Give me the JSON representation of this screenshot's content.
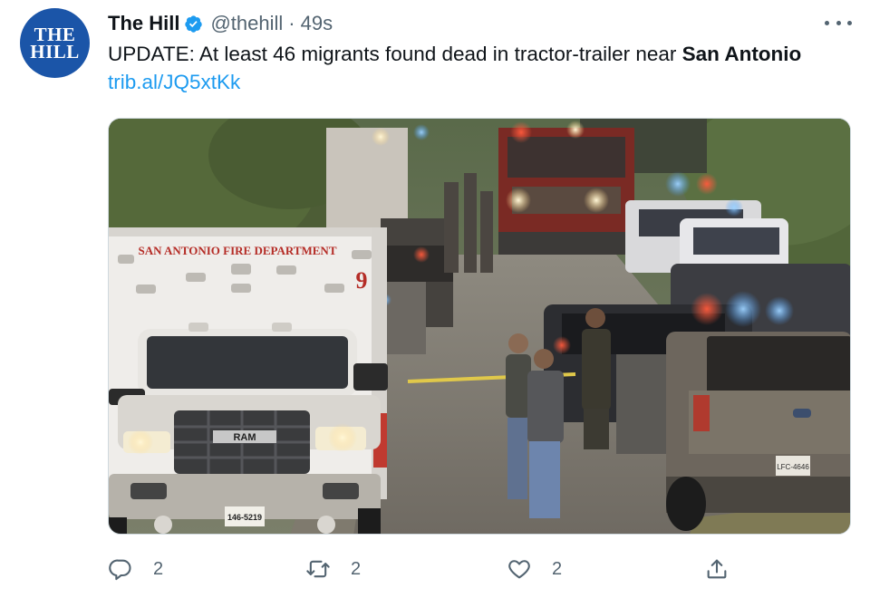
{
  "account": {
    "display_name": "The Hill",
    "handle": "@thehill",
    "separator": "·",
    "timestamp": "49s",
    "avatar_line1": "THE",
    "avatar_line2": "HILL",
    "verified": true
  },
  "tweet": {
    "text_prefix": "UPDATE: At least 46 migrants found dead in tractor-trailer near ",
    "text_bold": "San Antonio",
    "link": "trib.al/JQ5xtKk"
  },
  "media": {
    "ambulance_label": "SAN ANTONIO FIRE DEPARTMENT",
    "unit_number": "9",
    "grille_text": "RAM",
    "plate_text": "146-5219",
    "truck_plate": "LFC-4646"
  },
  "actions": {
    "reply_count": "2",
    "retweet_count": "2",
    "like_count": "2"
  },
  "colors": {
    "accent": "#1d9bf0",
    "secondary_text": "#536471",
    "avatar_bg": "#1b55a8"
  },
  "icons": [
    "verified-badge-icon",
    "more-icon",
    "reply-icon",
    "retweet-icon",
    "like-icon",
    "share-icon"
  ]
}
